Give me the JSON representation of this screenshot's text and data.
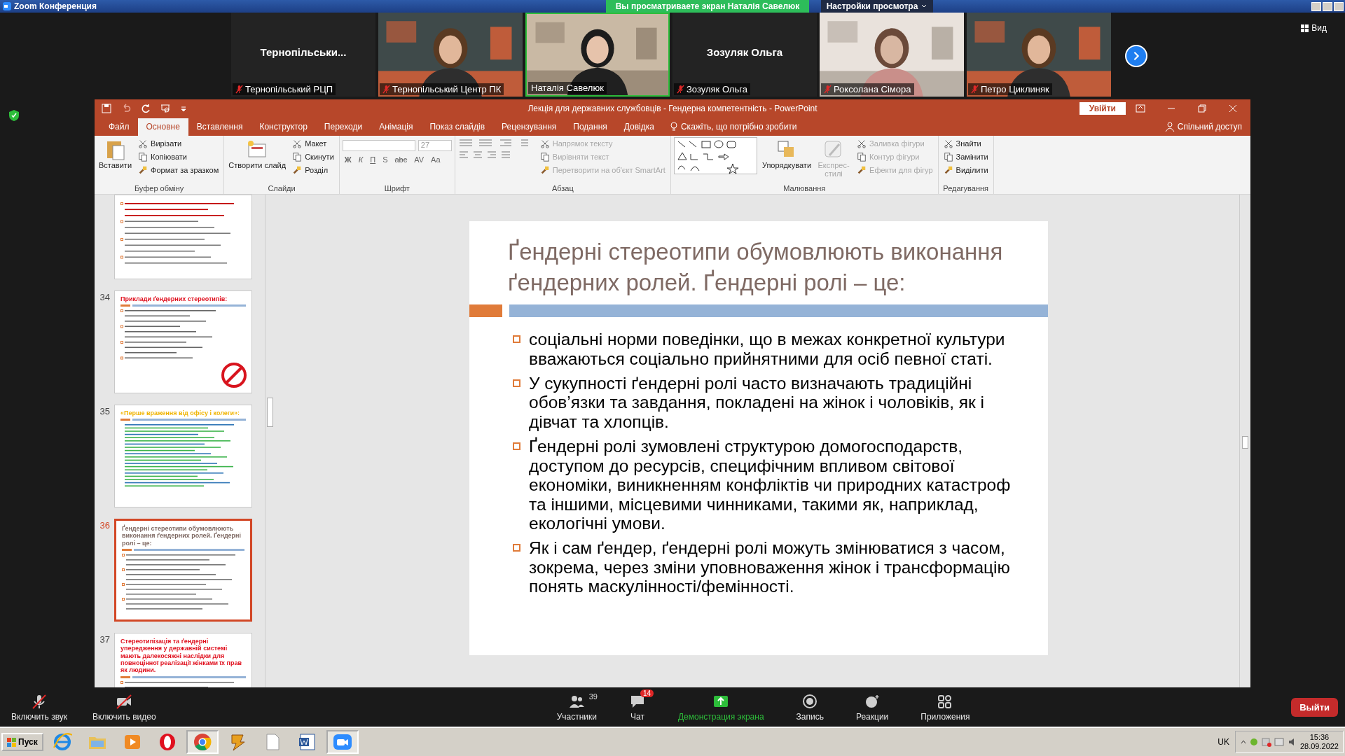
{
  "zoom": {
    "title": "Zoom Конференция",
    "banner": "Вы просматриваете экран Наталія Савелюк",
    "view_settings": "Настройки просмотра",
    "view_button": "Вид"
  },
  "participants": [
    {
      "kind": "name",
      "display": "Тернопільськи...",
      "label": "Тернопільський РЦП",
      "muted": true,
      "selected": false
    },
    {
      "kind": "picture",
      "label": "Тернопільський Центр ПК",
      "muted": true,
      "selected": false
    },
    {
      "kind": "picture",
      "label": "Наталія Савелюк",
      "muted": false,
      "selected": true
    },
    {
      "kind": "name",
      "display": "Зозуляк Ольга",
      "label": "Зозуляк Ольга",
      "muted": true,
      "selected": false
    },
    {
      "kind": "picture",
      "label": "Роксолана Сімора",
      "muted": true,
      "selected": false
    },
    {
      "kind": "picture",
      "label": "Петро Циклиняк",
      "muted": true,
      "selected": false
    }
  ],
  "powerpoint": {
    "title": "Лекція для державних службовців - Гендерна компетентність  -  PowerPoint",
    "sign_in": "Увійти",
    "tabs": [
      {
        "label": "Файл",
        "selected": false
      },
      {
        "label": "Основне",
        "selected": true
      },
      {
        "label": "Вставлення",
        "selected": false
      },
      {
        "label": "Конструктор",
        "selected": false
      },
      {
        "label": "Переходи",
        "selected": false
      },
      {
        "label": "Анімація",
        "selected": false
      },
      {
        "label": "Показ слайдів",
        "selected": false
      },
      {
        "label": "Рецензування",
        "selected": false
      },
      {
        "label": "Подання",
        "selected": false
      },
      {
        "label": "Довідка",
        "selected": false
      }
    ],
    "tell_me": "Скажіть, що потрібно зробити",
    "share": "Спільний доступ",
    "ribbon": [
      {
        "kind": "clipboard",
        "label": "Буфер обміну",
        "main": "Вставити",
        "commands": [
          {
            "label": "Вирізати",
            "disabled": false
          },
          {
            "label": "Копіювати",
            "disabled": false
          },
          {
            "label": "Формат за зразком",
            "disabled": false
          }
        ]
      },
      {
        "kind": "slides",
        "label": "Слайди",
        "main": "Створити слайд",
        "commands": [
          {
            "label": "Макет",
            "disabled": false
          },
          {
            "label": "Скинути",
            "disabled": false
          },
          {
            "label": "Розділ",
            "disabled": false
          }
        ]
      },
      {
        "kind": "font",
        "label": "Шрифт",
        "font_size": "27",
        "format_buttons": [
          "Ж",
          "К",
          "П",
          "S",
          "abc",
          "AV",
          "Aa"
        ]
      },
      {
        "kind": "paragraph",
        "label": "Абзац",
        "commands": [
          {
            "label": "Напрямок тексту",
            "disabled": true
          },
          {
            "label": "Вирівняти текст",
            "disabled": true
          },
          {
            "label": "Перетворити на об'єкт SmartArt",
            "disabled": true
          }
        ]
      },
      {
        "kind": "drawing",
        "label": "Малювання",
        "main": "Упорядкувати",
        "styles": {
          "label": "Експрес-стилі",
          "disabled": true
        },
        "commands": [
          {
            "label": "Заливка фігури",
            "disabled": true
          },
          {
            "label": "Контур фігури",
            "disabled": true
          },
          {
            "label": "Ефекти для фігур",
            "disabled": true
          }
        ]
      },
      {
        "kind": "editing",
        "label": "Редагування",
        "commands": [
          {
            "label": "Знайти",
            "disabled": false
          },
          {
            "label": "Замінити",
            "disabled": false
          },
          {
            "label": "Виділити",
            "disabled": false
          }
        ]
      }
    ],
    "slides": [
      {
        "kind": "top",
        "selected": false
      },
      {
        "kind": "sign",
        "number": "34",
        "selected": false,
        "title": "Приклади ґендерних стереотипів:",
        "color": "#e0101e"
      },
      {
        "kind": "lines",
        "number": "35",
        "selected": false,
        "title": "«Перше враження від офісу і колеги»:",
        "color": "#f0b400"
      },
      {
        "kind": "text",
        "number": "36",
        "selected": true,
        "title": "Ґендерні стереотипи обумовлюють виконання ґендерних ролей. Ґендерні ролі – це:",
        "color": "#7f6a64"
      },
      {
        "kind": "text",
        "number": "37",
        "selected": false,
        "title": "Стереотипізація та ґендерні упередження у державній системі мають далекосяжні наслідки для повноцінної реалізації жінками їх прав як людини.",
        "color": "#e0101e"
      }
    ],
    "current_slide": {
      "title": "Ґендерні стереотипи обумовлюють виконання ґендерних ролей. Ґендерні ролі – це:",
      "bullets": [
        "соціальні норми поведінки, що в межах конкретної культури вважаються соціально прийнятними для осіб певної статі.",
        "У сукупності ґендерні ролі часто визначають традиційні обов’язки та завдання, покладені на жінок і чоловіків, як і дівчат та хлопців.",
        "Ґендерні ролі  зумовлені структурою домогосподарств, доступом до ресурсів, специфічним впливом світової економіки, виникненням конфліктів чи природних катастроф та іншими, місцевими чинниками, такими як, наприклад, екологічні умови.",
        "Як і сам ґендер, ґендерні ролі можуть змінюватися з часом, зокрема, через зміни уповноваження жінок і трансформацію понять маскулінності/фемінності."
      ]
    }
  },
  "toolbar": [
    {
      "kind": "mic",
      "label": "Включить звук"
    },
    {
      "kind": "video",
      "label": "Включить видео"
    },
    {
      "kind": "participants",
      "label": "Участники",
      "count": "39"
    },
    {
      "kind": "chat",
      "label": "Чат",
      "badge": "14"
    },
    {
      "kind": "share",
      "label": "Демонстрация экрана"
    },
    {
      "kind": "record",
      "label": "Запись"
    },
    {
      "kind": "reactions",
      "label": "Реакции"
    },
    {
      "kind": "apps",
      "label": "Приложения"
    }
  ],
  "leave": "Выйти",
  "taskbar": {
    "start": "Пуск",
    "apps": [
      {
        "kind": "ie",
        "selected": false
      },
      {
        "kind": "folder",
        "selected": false
      },
      {
        "kind": "media",
        "selected": false
      },
      {
        "kind": "opera",
        "selected": false
      },
      {
        "kind": "chrome",
        "selected": true
      },
      {
        "kind": "app",
        "selected": false
      },
      {
        "kind": "document",
        "selected": false
      },
      {
        "kind": "word",
        "selected": false
      },
      {
        "kind": "zoom",
        "selected": true
      }
    ],
    "language": "UK",
    "time": "15:36",
    "date": "28.09.2022"
  }
}
